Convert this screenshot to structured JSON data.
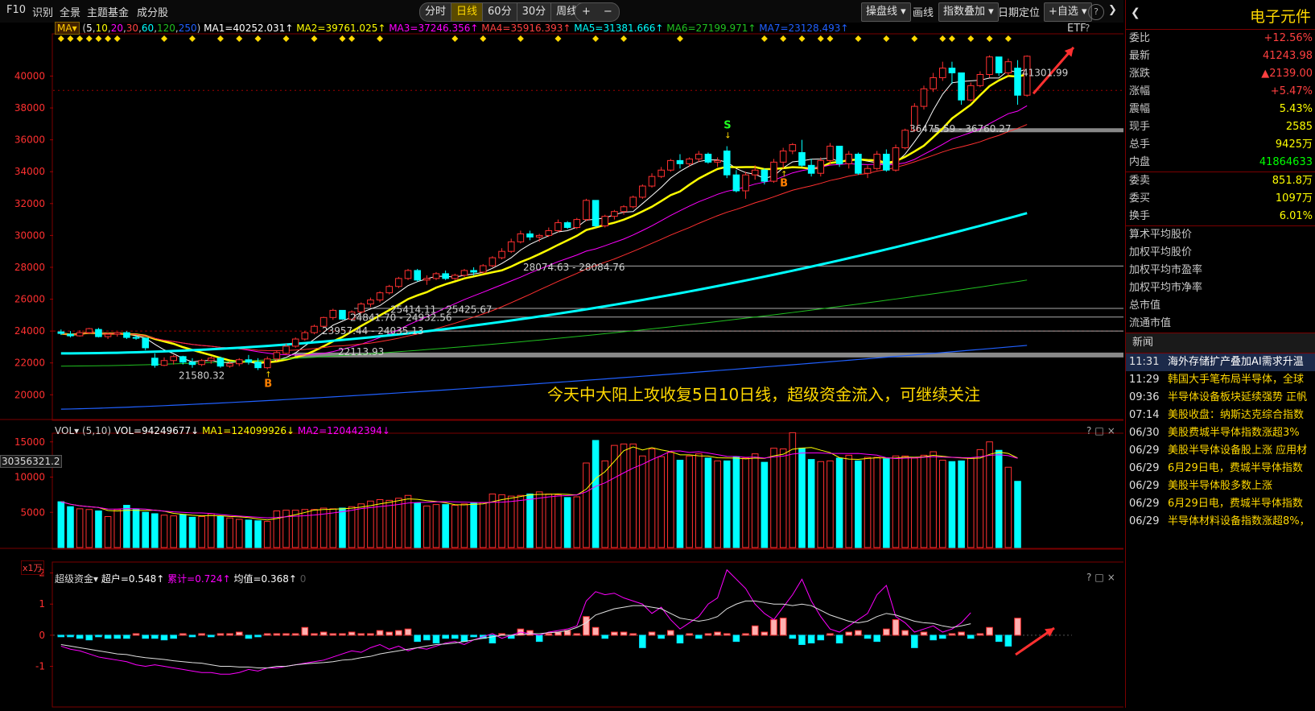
{
  "menu": [
    "F10",
    "识别",
    "全景",
    "主题基金",
    "成分股"
  ],
  "periods": [
    "分时",
    "日线",
    "60分",
    "30分",
    "周线"
  ],
  "active_period": "日线",
  "zoom": [
    "+",
    "−"
  ],
  "tools": [
    "操盘线",
    "画线",
    "指数叠加",
    "日期定位",
    "+自选"
  ],
  "main_legend": {
    "selector": "MA",
    "params": "(5,10,20,30,60,120,250)",
    "items": [
      {
        "text": "MA1=40252.031↑",
        "color": "#ffffff"
      },
      {
        "text": "MA2=39761.025↑",
        "color": "#ffff00"
      },
      {
        "text": "MA3=37246.356↑",
        "color": "#ff00ff"
      },
      {
        "text": "MA4=35916.393↑",
        "color": "#ff4040"
      },
      {
        "text": "MA5=31381.666↑",
        "color": "#00ffff"
      },
      {
        "text": "MA6=27199.971↑",
        "color": "#20c020"
      },
      {
        "text": "MA7=23128.493↑",
        "color": "#2060ff"
      }
    ]
  },
  "etf_label": "ETF",
  "price_axis": [
    "40000",
    "38000",
    "36000",
    "34000",
    "32000",
    "30000",
    "28000",
    "26000",
    "24000",
    "22000",
    "20000"
  ],
  "price_annotations": [
    "41301.99",
    "36475.59 - 36760.27",
    "28074.63 - 28084.76",
    "25414.11 - 25425.67",
    "24841.70 - 24932.56",
    "23957.44 - 24035.13",
    "22113.93",
    "21580.32"
  ],
  "signals": [
    "S",
    "B",
    "B"
  ],
  "annotation": "今天中大阳上攻收复5日10日线，超级资金流入，可继续关注",
  "vol_legend": {
    "selector": "VOL",
    "params": "(5,10)",
    "items": [
      {
        "text": "VOL=94249677↓",
        "color": "#ffffff"
      },
      {
        "text": "MA1=124099926↓",
        "color": "#ffff00"
      },
      {
        "text": "MA2=120442394↓",
        "color": "#ff00ff"
      }
    ]
  },
  "vol_axis": [
    "15000",
    "10000",
    "5000"
  ],
  "vol_cursor": "30356321.2",
  "vol_unit": "x1万",
  "fund_legend": {
    "selector": "超级资金",
    "items": [
      {
        "text": "超户=0.548↑",
        "color": "#ffffff"
      },
      {
        "text": "累计=0.724↑",
        "color": "#ff00ff"
      },
      {
        "text": "均值=0.368↑",
        "color": "#ffffff"
      },
      {
        "text": "0",
        "color": "#555555"
      }
    ]
  },
  "fund_axis": [
    "2",
    "1",
    "0",
    "-1"
  ],
  "panel_icons": [
    "?",
    "□",
    "×"
  ],
  "sidebar": {
    "title": "电子元件",
    "quote": [
      {
        "label": "委比",
        "value": "+12.56%",
        "color": "#ff4040"
      },
      {
        "label": "最新",
        "value": "41243.98",
        "color": "#ff4040"
      },
      {
        "label": "涨跌",
        "value": "▲2139.00",
        "color": "#ff4040"
      },
      {
        "label": "涨幅",
        "value": "+5.47%",
        "color": "#ff4040"
      },
      {
        "label": "震幅",
        "value": "5.43%",
        "color": "#ffff00"
      },
      {
        "label": "现手",
        "value": "2585",
        "color": "#ffff00"
      },
      {
        "label": "总手",
        "value": "9425万",
        "color": "#ffff00"
      },
      {
        "label": "内盘",
        "value": "41864633",
        "color": "#00ff00"
      }
    ],
    "orders": [
      {
        "label": "委卖",
        "value": "851.8万",
        "color": "#ffff00"
      },
      {
        "label": "委买",
        "value": "1097万",
        "color": "#ffff00"
      },
      {
        "label": "换手",
        "value": "6.01%",
        "color": "#ffff00"
      }
    ],
    "metrics": [
      "算术平均股价",
      "加权平均股价",
      "加权平均市盈率",
      "加权平均市净率",
      "总市值",
      "流通市值"
    ],
    "news_header": "新闻",
    "news": [
      {
        "time": "11:31",
        "text": "海外存储扩产叠加AI需求升温"
      },
      {
        "time": "11:29",
        "text": "韩国大手笔布局半导体，全球"
      },
      {
        "time": "09:36",
        "text": "半导体设备板块延续强势 正帆"
      },
      {
        "time": "07:14",
        "text": "美股收盘：纳斯达克综合指数"
      },
      {
        "time": "06/30",
        "text": "美股费城半导体指数涨超3%"
      },
      {
        "time": "06/29",
        "text": "美股半导体设备股上涨 应用材"
      },
      {
        "time": "06/29",
        "text": "6月29日电，费城半导体指数"
      },
      {
        "time": "06/29",
        "text": "美股半导体股多数上涨"
      },
      {
        "time": "06/29",
        "text": "6月29日电，费城半导体指数"
      },
      {
        "time": "06/29",
        "text": "半导体材料设备指数涨超8%，"
      }
    ]
  },
  "chart_data": {
    "type": "candlestick",
    "price_range": [
      18500,
      42500
    ],
    "candles": [
      [
        23950,
        24100,
        23750,
        23850
      ],
      [
        23800,
        24000,
        23600,
        23700
      ],
      [
        23700,
        24050,
        23650,
        23900
      ],
      [
        23900,
        24200,
        23800,
        24150
      ],
      [
        24100,
        24200,
        23600,
        23650
      ],
      [
        23650,
        23900,
        23500,
        23800
      ],
      [
        23800,
        23950,
        23650,
        23900
      ],
      [
        23900,
        24000,
        23500,
        23600
      ],
      [
        23600,
        23750,
        23450,
        23550
      ],
      [
        23550,
        23600,
        22800,
        22950
      ],
      [
        22300,
        22600,
        21700,
        21850
      ],
      [
        21850,
        22350,
        21800,
        22150
      ],
      [
        22150,
        22500,
        21900,
        22400
      ],
      [
        22400,
        22450,
        21900,
        22050
      ],
      [
        22050,
        22300,
        21700,
        21900
      ],
      [
        21900,
        22250,
        21800,
        22150
      ],
      [
        22150,
        22400,
        21950,
        22300
      ],
      [
        22300,
        22400,
        21700,
        21800
      ],
      [
        21800,
        22100,
        21700,
        21950
      ],
      [
        21950,
        22300,
        21800,
        22200
      ],
      [
        22200,
        22500,
        21900,
        22050
      ],
      [
        22050,
        22300,
        21550,
        21700
      ],
      [
        21700,
        22400,
        21600,
        22250
      ],
      [
        22250,
        22800,
        22100,
        22650
      ],
      [
        22600,
        23200,
        22500,
        23050
      ],
      [
        23050,
        23600,
        22950,
        23500
      ],
      [
        23500,
        24000,
        23400,
        23900
      ],
      [
        23900,
        24400,
        23800,
        24300
      ],
      [
        24300,
        24900,
        24200,
        24850
      ],
      [
        24850,
        25400,
        24700,
        25300
      ],
      [
        25300,
        25200,
        24700,
        24750
      ],
      [
        24750,
        25300,
        24700,
        25200
      ],
      [
        25200,
        25800,
        25100,
        25700
      ],
      [
        25700,
        26100,
        25500,
        25950
      ],
      [
        25950,
        26500,
        25800,
        26400
      ],
      [
        26400,
        26900,
        26300,
        26800
      ],
      [
        26800,
        27400,
        26700,
        27300
      ],
      [
        27300,
        27900,
        27200,
        27800
      ],
      [
        27800,
        27900,
        27100,
        27200
      ],
      [
        27200,
        27500,
        26900,
        27300
      ],
      [
        27300,
        27700,
        27200,
        27600
      ],
      [
        27600,
        27800,
        27200,
        27300
      ],
      [
        27300,
        27600,
        27200,
        27500
      ],
      [
        27500,
        27900,
        27400,
        27800
      ],
      [
        27800,
        28000,
        27500,
        27700
      ],
      [
        27700,
        28200,
        27600,
        28100
      ],
      [
        28100,
        28700,
        28000,
        28600
      ],
      [
        28600,
        29200,
        28500,
        29000
      ],
      [
        29000,
        29800,
        28900,
        29600
      ],
      [
        29600,
        30300,
        29500,
        30100
      ],
      [
        30100,
        30300,
        29700,
        29900
      ],
      [
        29900,
        30100,
        29600,
        30000
      ],
      [
        30000,
        30500,
        29900,
        30300
      ],
      [
        30300,
        31000,
        30200,
        30800
      ],
      [
        30800,
        30900,
        30400,
        30500
      ],
      [
        30500,
        31100,
        30400,
        31000
      ],
      [
        31000,
        32300,
        30900,
        32200
      ],
      [
        32200,
        31900,
        30500,
        30600
      ],
      [
        30600,
        31300,
        30500,
        31200
      ],
      [
        31200,
        31600,
        31000,
        31500
      ],
      [
        31500,
        31900,
        31300,
        31800
      ],
      [
        31800,
        32500,
        31700,
        32400
      ],
      [
        32400,
        33200,
        32300,
        33100
      ],
      [
        33100,
        33900,
        33000,
        33700
      ],
      [
        33700,
        34300,
        33600,
        34100
      ],
      [
        34100,
        34800,
        34000,
        34700
      ],
      [
        34700,
        35100,
        34200,
        34500
      ],
      [
        34500,
        34900,
        34300,
        34800
      ],
      [
        34800,
        35300,
        34600,
        35100
      ],
      [
        35100,
        35200,
        34500,
        34600
      ],
      [
        34600,
        34900,
        34300,
        34700
      ],
      [
        35300,
        35600,
        33600,
        33800
      ],
      [
        33800,
        34100,
        32700,
        32800
      ],
      [
        32800,
        34000,
        32300,
        33800
      ],
      [
        33800,
        34400,
        33500,
        34100
      ],
      [
        34100,
        34200,
        33200,
        33400
      ],
      [
        33400,
        34800,
        33300,
        34600
      ],
      [
        34600,
        35500,
        34200,
        35300
      ],
      [
        35300,
        35800,
        35100,
        35700
      ],
      [
        35200,
        36000,
        34300,
        34400
      ],
      [
        34400,
        34800,
        33700,
        33900
      ],
      [
        33900,
        34900,
        33700,
        34700
      ],
      [
        34700,
        35800,
        34400,
        35600
      ],
      [
        35600,
        35400,
        34300,
        34500
      ],
      [
        34500,
        35300,
        34200,
        35100
      ],
      [
        35100,
        35200,
        33800,
        33900
      ],
      [
        33900,
        34400,
        33600,
        34200
      ],
      [
        34200,
        35300,
        34100,
        35100
      ],
      [
        35100,
        35400,
        34000,
        34100
      ],
      [
        34100,
        35700,
        34000,
        35500
      ],
      [
        35500,
        36700,
        35400,
        36600
      ],
      [
        36600,
        38300,
        36500,
        38100
      ],
      [
        38100,
        39400,
        37900,
        39200
      ],
      [
        39200,
        40200,
        39000,
        39900
      ],
      [
        39900,
        40900,
        39700,
        40500
      ],
      [
        40500,
        40900,
        39500,
        40200
      ],
      [
        40200,
        39500,
        38200,
        38500
      ],
      [
        38500,
        39600,
        38400,
        39400
      ],
      [
        39400,
        40300,
        39300,
        40100
      ],
      [
        40100,
        41300,
        39900,
        41200
      ],
      [
        41200,
        41000,
        40000,
        40200
      ],
      [
        40200,
        41100,
        40000,
        40900
      ],
      [
        40500,
        41000,
        38200,
        38800
      ],
      [
        38800,
        41300,
        38700,
        41244
      ]
    ],
    "volume_range": [
      0,
      16000
    ],
    "volume": [
      6500,
      5800,
      5500,
      5400,
      5200,
      4400,
      5400,
      6000,
      5400,
      5000,
      4800,
      4600,
      4500,
      4700,
      4300,
      4400,
      4800,
      4400,
      4200,
      4000,
      3900,
      3800,
      3700,
      5200,
      5300,
      5300,
      5400,
      5400,
      5600,
      5500,
      5600,
      5800,
      6200,
      6600,
      6800,
      6700,
      7000,
      7400,
      6300,
      5900,
      6100,
      6100,
      6000,
      6200,
      6300,
      6400,
      7600,
      7500,
      7300,
      7400,
      7600,
      7900,
      7600,
      7500,
      7100,
      7200,
      12000,
      15200,
      12300,
      14500,
      14700,
      14700,
      13000,
      14000,
      12900,
      13500,
      12400,
      13000,
      13300,
      12700,
      12300,
      12300,
      12900,
      12700,
      13300,
      12100,
      14100,
      14000,
      16300,
      14100,
      12500,
      12200,
      12300,
      12700,
      13100,
      12300,
      12800,
      12800,
      12600,
      13000,
      13000,
      12700,
      13100,
      13600,
      12400,
      12200,
      12300,
      12700,
      13900,
      15000,
      13800,
      11400,
      9400
    ],
    "fund_range": [
      -1.4,
      2.3
    ],
    "fund_bars": [
      -0.05,
      -0.05,
      -0.1,
      -0.15,
      -0.05,
      -0.1,
      -0.1,
      -0.1,
      0.05,
      -0.1,
      -0.1,
      -0.15,
      -0.1,
      0.05,
      -0.05,
      0.05,
      -0.05,
      0.05,
      0.05,
      0.1,
      -0.1,
      -0.05,
      0.05,
      0.05,
      0.05,
      0.05,
      0.25,
      0.05,
      0.1,
      0.05,
      0.05,
      0.1,
      0.05,
      0.05,
      0.15,
      0.1,
      0.15,
      0.2,
      -0.2,
      -0.15,
      -0.25,
      -0.1,
      -0.1,
      -0.2,
      -0.05,
      -0.1,
      -0.25,
      0.05,
      -0.1,
      0.2,
      0.15,
      -0.2,
      0.05,
      0.1,
      0.15,
      0.05,
      0.6,
      0.25,
      -0.1,
      0.1,
      0.1,
      0.05,
      -0.4,
      0.1,
      -0.1,
      0.15,
      -0.25,
      0.05,
      -0.1,
      0.05,
      0.1,
      0.05,
      -0.2,
      0.05,
      0.3,
      0.1,
      0.5,
      0.55,
      -0.1,
      -0.3,
      -0.25,
      -0.15,
      0.05,
      -0.25,
      0.1,
      0.15,
      -0.1,
      -0.2,
      0.2,
      0.5,
      0.15,
      -0.4,
      0.1,
      -0.15,
      -0.1,
      0.05,
      0.1,
      -0.1,
      0.05,
      0.25,
      -0.2,
      -0.35,
      0.548
    ],
    "fund_cum": [
      -0.35,
      -0.45,
      -0.5,
      -0.6,
      -0.7,
      -0.75,
      -0.8,
      -0.85,
      -0.95,
      -1.0,
      -0.95,
      -1.0,
      -1.05,
      -1.1,
      -1.15,
      -1.2,
      -1.2,
      -1.25,
      -1.25,
      -1.2,
      -1.1,
      -1.15,
      -1.05,
      -1.05,
      -1.0,
      -0.95,
      -0.9,
      -0.85,
      -0.8,
      -0.7,
      -0.6,
      -0.5,
      -0.55,
      -0.4,
      -0.3,
      -0.45,
      -0.35,
      -0.5,
      -0.4,
      -0.45,
      -0.35,
      -0.25,
      -0.2,
      -0.3,
      -0.15,
      -0.05,
      0.05,
      -0.1,
      0.0,
      0.1,
      0.05,
      0.0,
      0.1,
      0.15,
      0.2,
      0.3,
      1.1,
      1.4,
      1.3,
      1.35,
      1.2,
      1.1,
      1.0,
      0.7,
      0.9,
      0.5,
      0.2,
      0.4,
      0.6,
      1.0,
      1.2,
      2.1,
      1.8,
      1.5,
      1.0,
      0.7,
      0.5,
      0.9,
      1.3,
      1.8,
      1.1,
      0.6,
      0.2,
      0.1,
      0.3,
      0.5,
      0.7,
      1.3,
      1.6,
      0.6,
      0.4,
      0.1,
      0.2,
      0.3,
      0.1,
      0.2,
      0.4,
      0.724
    ],
    "fund_avg": [
      -0.3,
      -0.35,
      -0.4,
      -0.45,
      -0.5,
      -0.55,
      -0.6,
      -0.62,
      -0.68,
      -0.72,
      -0.75,
      -0.78,
      -0.82,
      -0.85,
      -0.88,
      -0.9,
      -0.95,
      -1.0,
      -1.0,
      -1.02,
      -1.02,
      -1.05,
      -1.05,
      -1.0,
      -1.0,
      -0.95,
      -0.92,
      -0.9,
      -0.88,
      -0.85,
      -0.8,
      -0.78,
      -0.72,
      -0.68,
      -0.6,
      -0.55,
      -0.5,
      -0.45,
      -0.4,
      -0.35,
      -0.3,
      -0.28,
      -0.25,
      -0.2,
      -0.15,
      -0.1,
      -0.05,
      0.0,
      0.0,
      0.02,
      0.05,
      0.05,
      0.08,
      0.1,
      0.15,
      0.25,
      0.4,
      0.65,
      0.75,
      0.85,
      0.9,
      0.95,
      0.95,
      0.9,
      0.85,
      0.7,
      0.55,
      0.5,
      0.45,
      0.5,
      0.6,
      0.85,
      1.0,
      1.1,
      1.1,
      1.05,
      1.0,
      1.0,
      0.95,
      1.0,
      0.95,
      0.8,
      0.65,
      0.55,
      0.45,
      0.4,
      0.45,
      0.6,
      0.7,
      0.65,
      0.55,
      0.45,
      0.4,
      0.38,
      0.3,
      0.25,
      0.3,
      0.368
    ]
  }
}
